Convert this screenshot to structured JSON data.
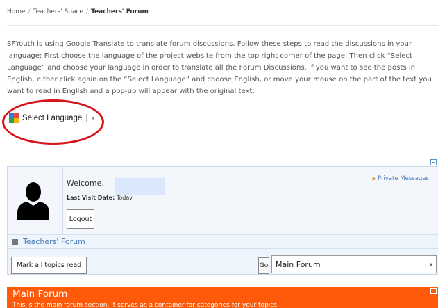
{
  "breadcrumb": [
    "Home",
    "Teachers' Space",
    "Teachers' Forum"
  ],
  "intro_lines": [
    "SFYouth is using Google Translate to translate forum discussions. Follow these steps to read the discussions in your",
    "language: First choose the language of the project website from the top right corner of the page. Then click “Select",
    "Language” and choose your language in order to translate all the Forum Discussions. If you want to see the posts in",
    "English, either click again on the “Select Language” and choose English, or move your mouse on the part of the text you",
    "want to read in English and a pop-up will appear with the original text."
  ],
  "translate": {
    "label": "Select Language",
    "icon": "google-translate-icon"
  },
  "welcome": {
    "greeting": "Welcome,",
    "last_visit_label": "Last Visit Date:",
    "last_visit_value": "Today",
    "logout_label": "Logout",
    "private_messages_label": "Private Messages"
  },
  "forum": {
    "title": "Teachers' Forum",
    "mark_read_label": "Mark all topics read",
    "go_label": "Go",
    "selected_forum": "Main Forum"
  },
  "main_forum": {
    "title": "Main Forum",
    "description": "This is the main forum section. It serves as a container for categories for your topics."
  },
  "colors": {
    "accent_orange": "#ff5a0a",
    "link_blue": "#4a7bbd",
    "highlight_red": "#d7141b",
    "panel_bg": "#eef4fb"
  }
}
